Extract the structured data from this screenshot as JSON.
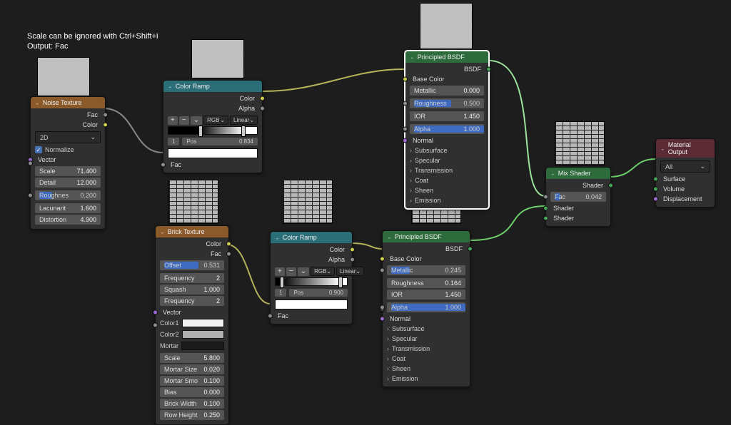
{
  "instruction": {
    "line1": "Scale can be ignored with Ctrl+Shift+i",
    "line2": "Output: Fac"
  },
  "noise": {
    "title": "Noise Texture",
    "outputs": {
      "fac": "Fac",
      "color": "Color"
    },
    "dim": "2D",
    "normalize_label": "Normalize",
    "normalize": true,
    "vector": "Vector",
    "params": {
      "scale": {
        "label": "Scale",
        "value": "71.400"
      },
      "detail": {
        "label": "Detail",
        "value": "12.000"
      },
      "roughness": {
        "label": "Roughnes",
        "value": "0.200"
      },
      "lacunarity": {
        "label": "Lacunarit",
        "value": "1.600"
      },
      "distortion": {
        "label": "Distortion",
        "value": "4.900"
      }
    }
  },
  "colorramp1": {
    "title": "Color Ramp",
    "outputs": {
      "color": "Color",
      "alpha": "Alpha"
    },
    "mode1": "RGB",
    "mode2": "Linear",
    "stop_index": "1",
    "pos_label": "Pos",
    "pos_value": "0.834",
    "input": "Fac"
  },
  "colorramp2": {
    "title": "Color Ramp",
    "outputs": {
      "color": "Color",
      "alpha": "Alpha"
    },
    "mode1": "RGB",
    "mode2": "Linear",
    "stop_index": "1",
    "pos_label": "Pos",
    "pos_value": "0.900",
    "input": "Fac"
  },
  "brick": {
    "title": "Brick Texture",
    "outputs": {
      "color": "Color",
      "fac": "Fac"
    },
    "offset": {
      "label": "Offset",
      "value": "0.531"
    },
    "frequency1": {
      "label": "Frequency",
      "value": "2"
    },
    "squash": {
      "label": "Squash",
      "value": "1.000"
    },
    "frequency2": {
      "label": "Frequency",
      "value": "2"
    },
    "vector": "Vector",
    "color1": "Color1",
    "color2": "Color2",
    "mortar": "Mortar",
    "scale": {
      "label": "Scale",
      "value": "5.800"
    },
    "mortar_size": {
      "label": "Mortar Size",
      "value": "0.020"
    },
    "mortar_smo": {
      "label": "Mortar Smo",
      "value": "0.100"
    },
    "bias": {
      "label": "Bias",
      "value": "0.000"
    },
    "brick_width": {
      "label": "Brick Width",
      "value": "0.100"
    },
    "row_height": {
      "label": "Row Height",
      "value": "0.250"
    }
  },
  "principled1": {
    "title": "Principled BSDF",
    "bsdf": "BSDF",
    "base_color": "Base Color",
    "metallic": {
      "label": "Metallic",
      "value": "0.000"
    },
    "roughness": {
      "label": "Roughness",
      "value": "0.500"
    },
    "ior": {
      "label": "IOR",
      "value": "1.450"
    },
    "alpha": {
      "label": "Alpha",
      "value": "1.000"
    },
    "normal": "Normal",
    "groups": [
      "Subsurface",
      "Specular",
      "Transmission",
      "Coat",
      "Sheen",
      "Emission"
    ]
  },
  "principled2": {
    "title": "Principled BSDF",
    "bsdf": "BSDF",
    "base_color": "Base Color",
    "metallic": {
      "label": "Metallic",
      "value": "0.245"
    },
    "roughness": {
      "label": "Roughness",
      "value": "0.164"
    },
    "ior": {
      "label": "IOR",
      "value": "1.450"
    },
    "alpha": {
      "label": "Alpha",
      "value": "1.000"
    },
    "normal": "Normal",
    "groups": [
      "Subsurface",
      "Specular",
      "Transmission",
      "Coat",
      "Sheen",
      "Emission"
    ]
  },
  "mix": {
    "title": "Mix Shader",
    "out": "Shader",
    "fac": {
      "label": "Fac",
      "value": "0.042"
    },
    "shader1": "Shader",
    "shader2": "Shader"
  },
  "output": {
    "title": "Material Output",
    "target": "All",
    "surface": "Surface",
    "volume": "Volume",
    "displacement": "Displacement"
  }
}
